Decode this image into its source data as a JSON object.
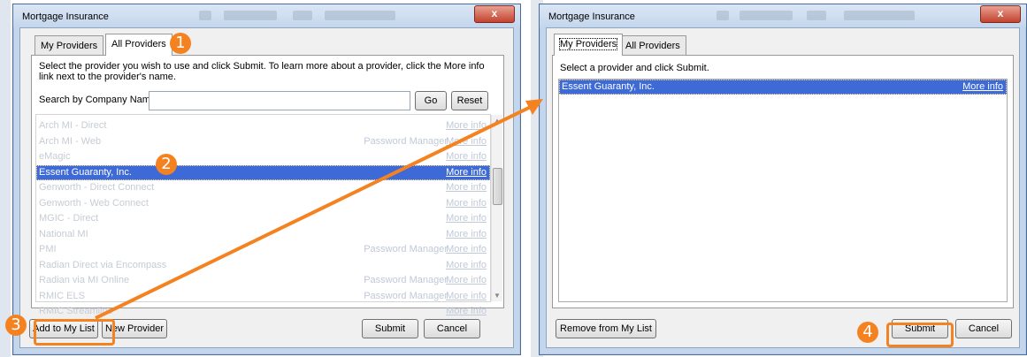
{
  "left_window": {
    "title": "Mortgage Insurance",
    "close_label": "x",
    "tabs": [
      {
        "label": "My Providers",
        "active": false
      },
      {
        "label": "All Providers",
        "active": true
      }
    ],
    "instruction": "Select the provider you wish to use and click Submit. To learn more about a provider, click the More info link next to the provider's name.",
    "search_label": "Search by Company Name:",
    "search_value": "",
    "go_label": "Go",
    "reset_label": "Reset",
    "providers": [
      {
        "name": "Arch MI - Direct",
        "password_manager": "",
        "more_info": "More info",
        "selected": false
      },
      {
        "name": "Arch MI - Web",
        "password_manager": "Password Manager",
        "more_info": "More info",
        "selected": false
      },
      {
        "name": "eMagic",
        "password_manager": "",
        "more_info": "More info",
        "selected": false
      },
      {
        "name": "Essent Guaranty, Inc.",
        "password_manager": "",
        "more_info": "More info",
        "selected": true
      },
      {
        "name": "Genworth - Direct Connect",
        "password_manager": "",
        "more_info": "More info",
        "selected": false
      },
      {
        "name": "Genworth - Web Connect",
        "password_manager": "",
        "more_info": "More info",
        "selected": false
      },
      {
        "name": "MGIC - Direct",
        "password_manager": "",
        "more_info": "More info",
        "selected": false
      },
      {
        "name": "National MI",
        "password_manager": "",
        "more_info": "More info",
        "selected": false
      },
      {
        "name": "PMI",
        "password_manager": "Password Manager",
        "more_info": "More info",
        "selected": false
      },
      {
        "name": "Radian Direct via Encompass",
        "password_manager": "",
        "more_info": "More info",
        "selected": false
      },
      {
        "name": "Radian via MI Online",
        "password_manager": "Password Manager",
        "more_info": "More info",
        "selected": false
      },
      {
        "name": "RMIC ELS",
        "password_manager": "Password Manager",
        "more_info": "More info",
        "selected": false
      },
      {
        "name": "RMIC Streamline",
        "password_manager": "",
        "more_info": "More info",
        "selected": false
      }
    ],
    "add_to_list_label": "Add to My List",
    "new_provider_label": "New Provider",
    "submit_label": "Submit",
    "cancel_label": "Cancel"
  },
  "right_window": {
    "title": "Mortgage Insurance",
    "close_label": "x",
    "tabs": [
      {
        "label": "My Providers",
        "active": true
      },
      {
        "label": "All Providers",
        "active": false
      }
    ],
    "instruction": "Select a provider and click Submit.",
    "providers": [
      {
        "name": "Essent Guaranty, Inc.",
        "more_info": "More info",
        "selected": true
      }
    ],
    "remove_label": "Remove from My List",
    "submit_label": "Submit",
    "cancel_label": "Cancel"
  },
  "callouts": [
    "1",
    "2",
    "3",
    "4"
  ],
  "colors": {
    "accent": "#f58220",
    "selection": "#3d6ad6",
    "window_frame": "#c4d6ec",
    "close_button": "#c4432f"
  }
}
